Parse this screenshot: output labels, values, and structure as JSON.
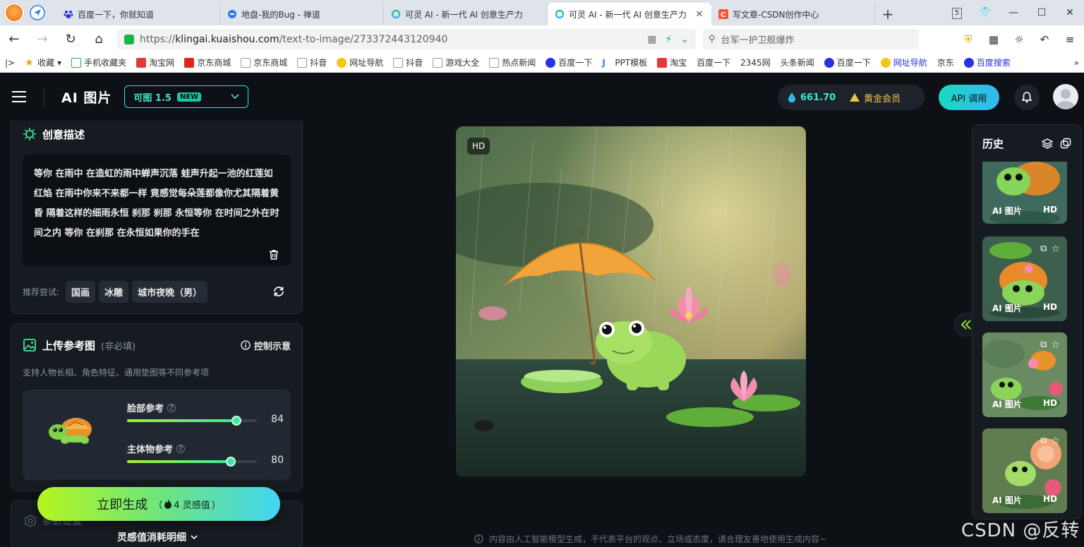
{
  "browser": {
    "tabs": [
      {
        "title": "百度一下，你就知道"
      },
      {
        "title": "地盘-我的Bug - 禅道"
      },
      {
        "title": "可灵 AI - 新一代 AI 创意生产力"
      },
      {
        "title": "可灵 AI - 新一代 AI 创意生产力",
        "active": true
      },
      {
        "title": "写文章-CSDN创作中心"
      }
    ],
    "window_badge": "5",
    "url_prefix": "https://",
    "url_host": "klingai.kuaishou.com",
    "url_path": "/text-to-image/273372443120940",
    "search_text": "台军一护卫舰爆炸",
    "bookmarks": [
      "收藏",
      "手机收藏夹",
      "淘宝网",
      "京东商城",
      "京东商城",
      "抖音",
      "网址导航",
      "抖音",
      "游戏大全",
      "热点新闻",
      "百度一下",
      "PPT模板",
      "淘宝",
      "百度一下",
      "2345网",
      "头条新闻",
      "百度一下",
      "网址导航",
      "京东",
      "百度搜索"
    ]
  },
  "app": {
    "title": "AI 图片",
    "model": "可图 1.5",
    "model_badge": "NEW",
    "credits": "661.70",
    "membership": "黄金会员",
    "api_label": "API 调用"
  },
  "describe": {
    "title": "创意描述",
    "prompt": "等你 在雨中 在造虹的雨中蝉声沉落 蛙声升起一池的红莲如红焰 在雨中你来不来都一样 竟感觉每朵莲都像你尤其隔着黄昏 隔着这样的细雨永恒 刹那 刹那 永恒等你 在时间之外在时间之内 等你 在刹那 在永恒如果你的手在",
    "suggest_label": "推荐尝试:",
    "suggestions": [
      "国画",
      "冰雕",
      "城市夜晚（男）"
    ]
  },
  "reference": {
    "title": "上传参考图",
    "optional": "(非必填)",
    "control_link": "控制示意",
    "subtitle": "支持人物长相、角色特征、通用垫图等不同参考项",
    "sliders": [
      {
        "label": "脸部参考",
        "value": 84
      },
      {
        "label": "主体物参考",
        "value": 80
      }
    ]
  },
  "params": {
    "title": "参数设置"
  },
  "generate": {
    "label": "立即生成",
    "cost_prefix": "（",
    "cost": "4 灵感值",
    "cost_suffix": "）"
  },
  "consume_detail": "灵感值消耗明细",
  "result": {
    "badge": "HD"
  },
  "disclaimer": "内容由人工智能模型生成，不代表平台的观点、立场或态度，请合理友善地使用生成内容~",
  "history": {
    "title": "历史",
    "items": [
      {
        "type": "AI 图片",
        "quality": "HD"
      },
      {
        "type": "AI 图片",
        "quality": "HD"
      },
      {
        "type": "AI 图片",
        "quality": "HD"
      },
      {
        "type": "AI 图片",
        "quality": "HD"
      }
    ]
  },
  "watermark": "CSDN @反转",
  "colors": {
    "accent": "#3ee8c9",
    "gold": "#f0c24b",
    "bg": "#0d1015",
    "panel": "#161b22"
  }
}
